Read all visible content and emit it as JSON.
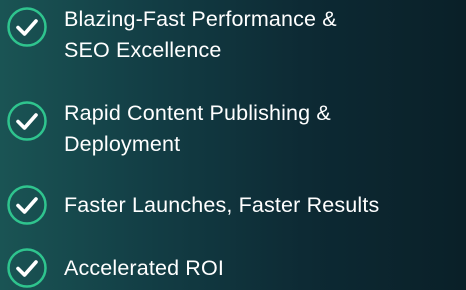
{
  "features": [
    {
      "icon": "check-circle-icon",
      "line1": "Blazing-Fast Performance &",
      "line2": "SEO Excellence"
    },
    {
      "icon": "check-circle-icon",
      "line1": "Rapid Content Publishing &",
      "line2": "Deployment"
    },
    {
      "icon": "check-circle-icon",
      "line1": "Faster Launches, Faster Results"
    },
    {
      "icon": "check-circle-icon",
      "line1": "Accelerated ROI"
    }
  ],
  "colors": {
    "icon_ring": "#2fc48e",
    "check_fill": "#ffffff",
    "text": "#ffffff"
  }
}
